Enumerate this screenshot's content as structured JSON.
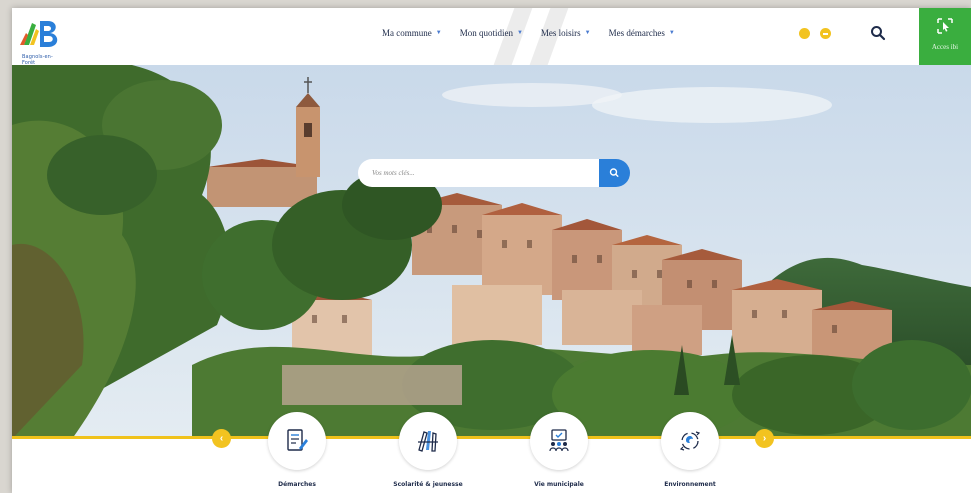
{
  "site": {
    "logo_text": "Bagnols-en-Forêt",
    "accent_blue": "#2a7fd9",
    "accent_yellow": "#f2c320",
    "accent_green": "#3aae3f"
  },
  "nav": {
    "items": [
      {
        "label": "Ma commune",
        "icon": "chevron-down-icon"
      },
      {
        "label": "Mon quotidien",
        "icon": "chevron-down-icon"
      },
      {
        "label": "Mes loisirs",
        "icon": "chevron-down-icon"
      },
      {
        "label": "Mes démarches",
        "icon": "chevron-down-icon"
      }
    ],
    "accessit_label": "Acces ibi"
  },
  "search": {
    "placeholder": "Vos mots clés..."
  },
  "quick_access": [
    {
      "label": "Démarches",
      "icon": "document-pen-icon"
    },
    {
      "label": "Scolarité & jeunesse",
      "icon": "pencils-icon"
    },
    {
      "label": "Vie municipale",
      "icon": "people-board-icon"
    },
    {
      "label": "Environnement",
      "icon": "recycle-icon"
    }
  ]
}
